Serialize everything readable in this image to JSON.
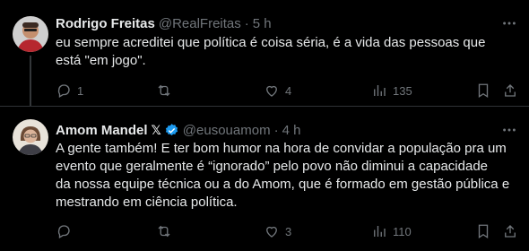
{
  "colors": {
    "background": "#000000",
    "text": "#e7e9ea",
    "muted": "#71767b",
    "verified": "#1d9bf0",
    "divider": "#2f3336"
  },
  "tweets": [
    {
      "name": "Rodrigo Freitas",
      "handle": "@RealFreitas",
      "dot": "·",
      "time": "5 h",
      "text_lines": [
        "eu sempre acreditei que política é coisa séria, é a vida das pessoas que",
        "está \"em jogo\"."
      ],
      "replies": "1",
      "retweets": "",
      "likes": "4",
      "views": "135",
      "more_icon": "more-horizontal-icon"
    },
    {
      "name": "Amom Mandel",
      "name_badge": "𝕏",
      "verified_icon": "verified-badge-icon",
      "handle": "@eusouamom",
      "dot": "·",
      "time": "4 h",
      "text_lines": [
        "A gente também! E ter bom humor na hora de convidar a população pra um",
        "evento que geralmente é “ignorado” pelo povo não diminui a capacidade",
        "da nossa equipe técnica ou a do Amom, que é formado em gestão pública e",
        "mestrando em ciência política."
      ],
      "replies": "",
      "retweets": "",
      "likes": "3",
      "views": "110",
      "more_icon": "more-horizontal-icon"
    }
  ]
}
